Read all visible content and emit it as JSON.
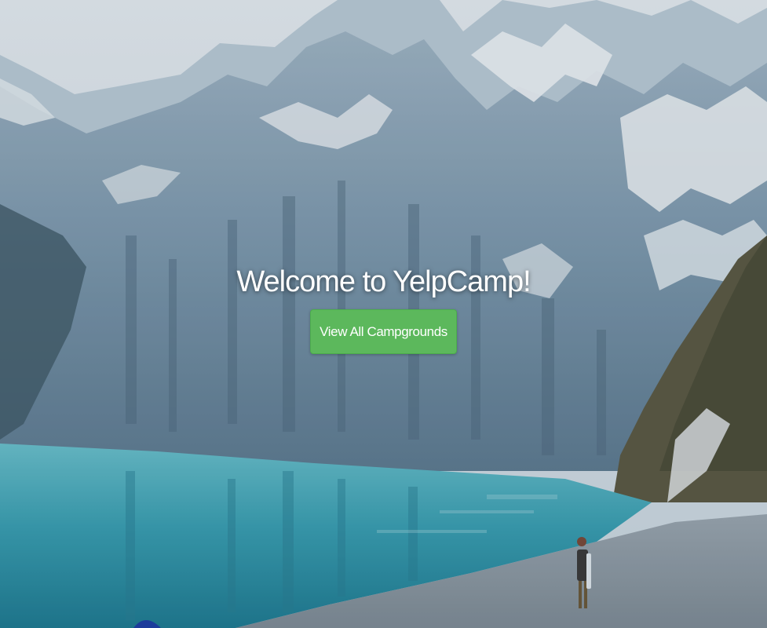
{
  "hero": {
    "title": "Welcome to YelpCamp!",
    "button_label": "View All Campgrounds"
  },
  "colors": {
    "button": "#5cb85c",
    "title_text": "#ffffff",
    "lake": "#3fa3b5",
    "sky": "#dfe8ee"
  }
}
